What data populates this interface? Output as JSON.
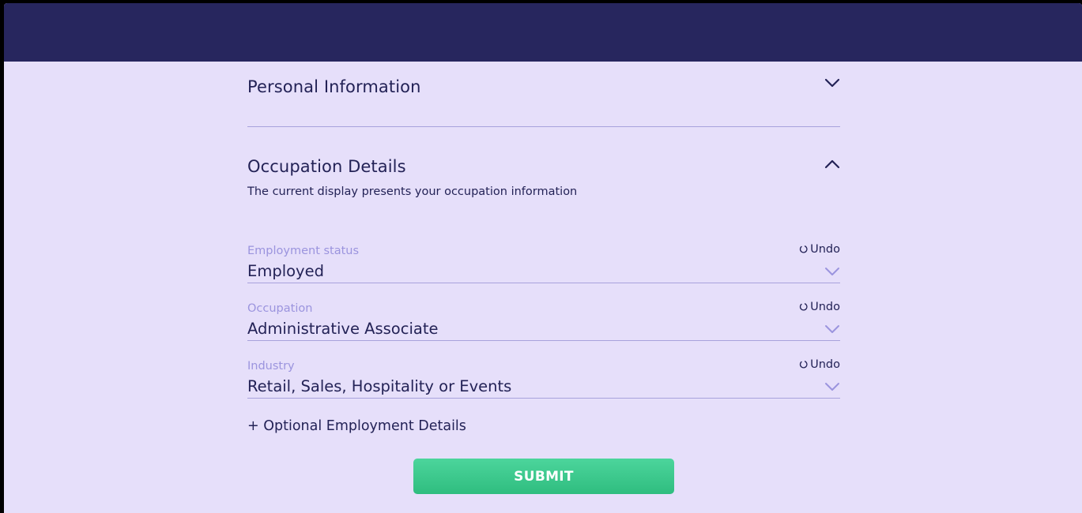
{
  "sections": {
    "personal": {
      "title": "Personal Information",
      "expanded": false
    },
    "occupation": {
      "title": "Occupation Details",
      "subtitle": "The current display presents your occupation information",
      "expanded": true
    }
  },
  "fields": [
    {
      "label": "Employment status",
      "value": "Employed",
      "undo_label": "Undo"
    },
    {
      "label": "Occupation",
      "value": "Administrative Associate",
      "undo_label": "Undo"
    },
    {
      "label": "Industry",
      "value": "Retail, Sales, Hospitality or Events",
      "undo_label": "Undo"
    }
  ],
  "optional_link": "+ Optional Employment Details",
  "submit_label": "SUBMIT",
  "colors": {
    "header": "#27265e",
    "background": "#e6dffa",
    "text": "#232256",
    "label": "#9b94de",
    "accent_green": "#34c485"
  },
  "icons": {
    "collapsed": "chevron-down-icon",
    "expanded": "chevron-up-icon",
    "undo": "undo-icon"
  }
}
